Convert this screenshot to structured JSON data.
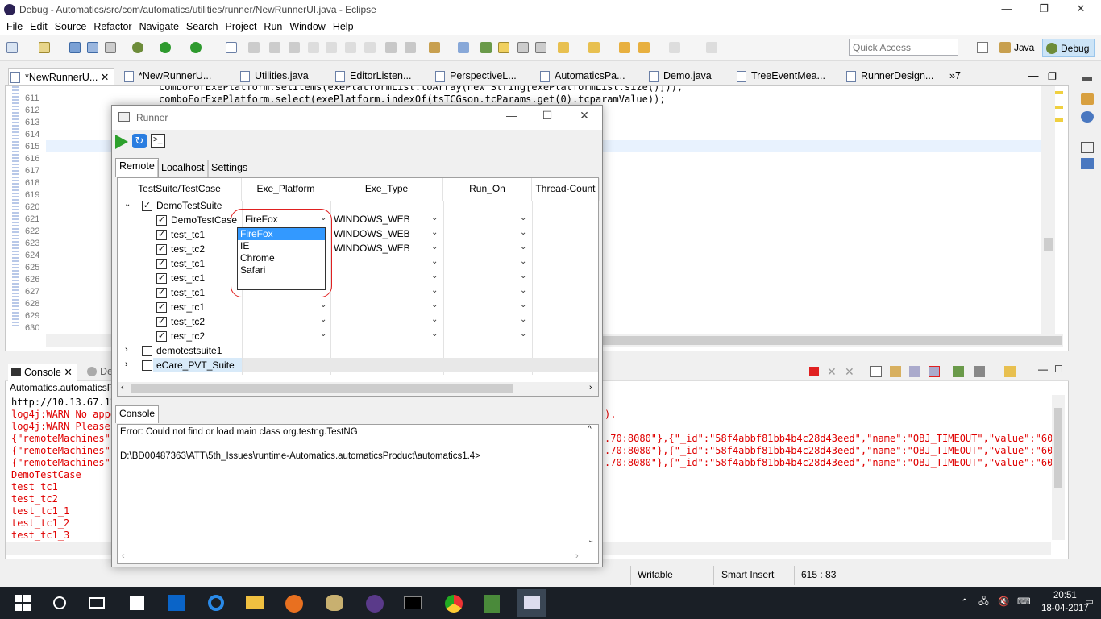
{
  "window": {
    "title": "Debug - Automatics/src/com/automatics/utilities/runner/NewRunnerUI.java - Eclipse",
    "minimize": "—",
    "maximize": "❐",
    "close": "✕"
  },
  "menu": [
    "File",
    "Edit",
    "Source",
    "Refactor",
    "Navigate",
    "Search",
    "Project",
    "Run",
    "Window",
    "Help"
  ],
  "quick_access": {
    "placeholder": "Quick Access"
  },
  "perspectives": {
    "java": "Java",
    "debug": "Debug"
  },
  "editor": {
    "tabs": [
      "*NewRunnerU...",
      "*NewRunnerU...",
      "Utilities.java",
      "EditorListen...",
      "PerspectiveL...",
      "AutomaticsPa...",
      "Demo.java",
      "TreeEventMea...",
      "RunnerDesign..."
    ],
    "overflow": "»7",
    "line_numbers": [
      "611",
      "612",
      "613",
      "614",
      "615",
      "616",
      "617",
      "618",
      "619",
      "620",
      "621",
      "622",
      "623",
      "624",
      "625",
      "626",
      "627",
      "628",
      "629",
      "630"
    ],
    "code_line_top": "comboForExePlatform.setItems(exePlatformList.toArray(new String[exePlatformList.size()]));",
    "code_line_611": "comboForExePlatform.select(exePlatform.indexOf(tsTCGson.tcParams.get(0).tcparamValue));"
  },
  "console_view": {
    "tabs": [
      "Console",
      "De"
    ],
    "lines": [
      "Automatics.automaticsP",
      "http://10.13.67.12",
      "log4j:WARN No appe",
      "log4j:WARN Please",
      "{\"remoteMachines\":",
      "{\"remoteMachines\":",
      "{\"remoteMachines\":",
      "DemoTestCase",
      "test_tc1",
      "test_tc2",
      "test_tc1_1",
      "test_tc1_2",
      "test_tc1_3"
    ],
    "right_fragments": [
      ").",
      ".70:8080\"},{\"_id\":\"58f4abbf81bb4b4c28d43eed\",\"name\":\"OBJ_TIMEOUT\",\"value\":\"60\"}",
      ".70:8080\"},{\"_id\":\"58f4abbf81bb4b4c28d43eed\",\"name\":\"OBJ_TIMEOUT\",\"value\":\"60\"}",
      ".70:8080\"},{\"_id\":\"58f4abbf81bb4b4c28d43eed\",\"name\":\"OBJ_TIMEOUT\",\"value\":\"60\"}"
    ]
  },
  "status": {
    "writable": "Writable",
    "insert": "Smart Insert",
    "position": "615 : 83"
  },
  "taskbar": {
    "time": "20:51",
    "date": "18-04-2017"
  },
  "runner": {
    "title": "Runner",
    "tabs": [
      "Remote",
      "Localhost",
      "Settings"
    ],
    "columns": [
      "TestSuite/TestCase",
      "Exe_Platform",
      "Exe_Type",
      "Run_On",
      "Thread-Count"
    ],
    "suites": [
      {
        "name": "DemoTestSuite",
        "checked": true,
        "expanded": true
      },
      {
        "name": "demotestsuite1",
        "checked": false,
        "expanded": false
      },
      {
        "name": "eCare_PVT_Suite",
        "checked": false,
        "expanded": false
      }
    ],
    "testcases": [
      {
        "name": "DemoTestCase",
        "platform": "FireFox",
        "type": "WINDOWS_WEB"
      },
      {
        "name": "test_tc1",
        "platform": "",
        "type": "WINDOWS_WEB"
      },
      {
        "name": "test_tc2",
        "platform": "",
        "type": "WINDOWS_WEB"
      },
      {
        "name": "test_tc1",
        "platform": "",
        "type": ""
      },
      {
        "name": "test_tc1",
        "platform": "",
        "type": ""
      },
      {
        "name": "test_tc1",
        "platform": "",
        "type": ""
      },
      {
        "name": "test_tc1",
        "platform": "",
        "type": ""
      },
      {
        "name": "test_tc2",
        "platform": "",
        "type": ""
      },
      {
        "name": "test_tc2",
        "platform": "",
        "type": ""
      }
    ],
    "dropdown_options": [
      "FireFox",
      "IE",
      "Chrome",
      "Safari"
    ],
    "dropdown_selected": "FireFox",
    "console_label": "Console",
    "console_lines": [
      "Error: Could not find or load main class org.testng.TestNG",
      "",
      "D:\\BD00487363\\ATT\\5th_Issues\\runtime-Automatics.automaticsProduct\\automatics1.4>"
    ]
  },
  "colors": {
    "accent_selection": "#3399ff",
    "console_error": "#e00000",
    "current_line": "#e8f2fe",
    "taskbar": "#1a1f26"
  }
}
